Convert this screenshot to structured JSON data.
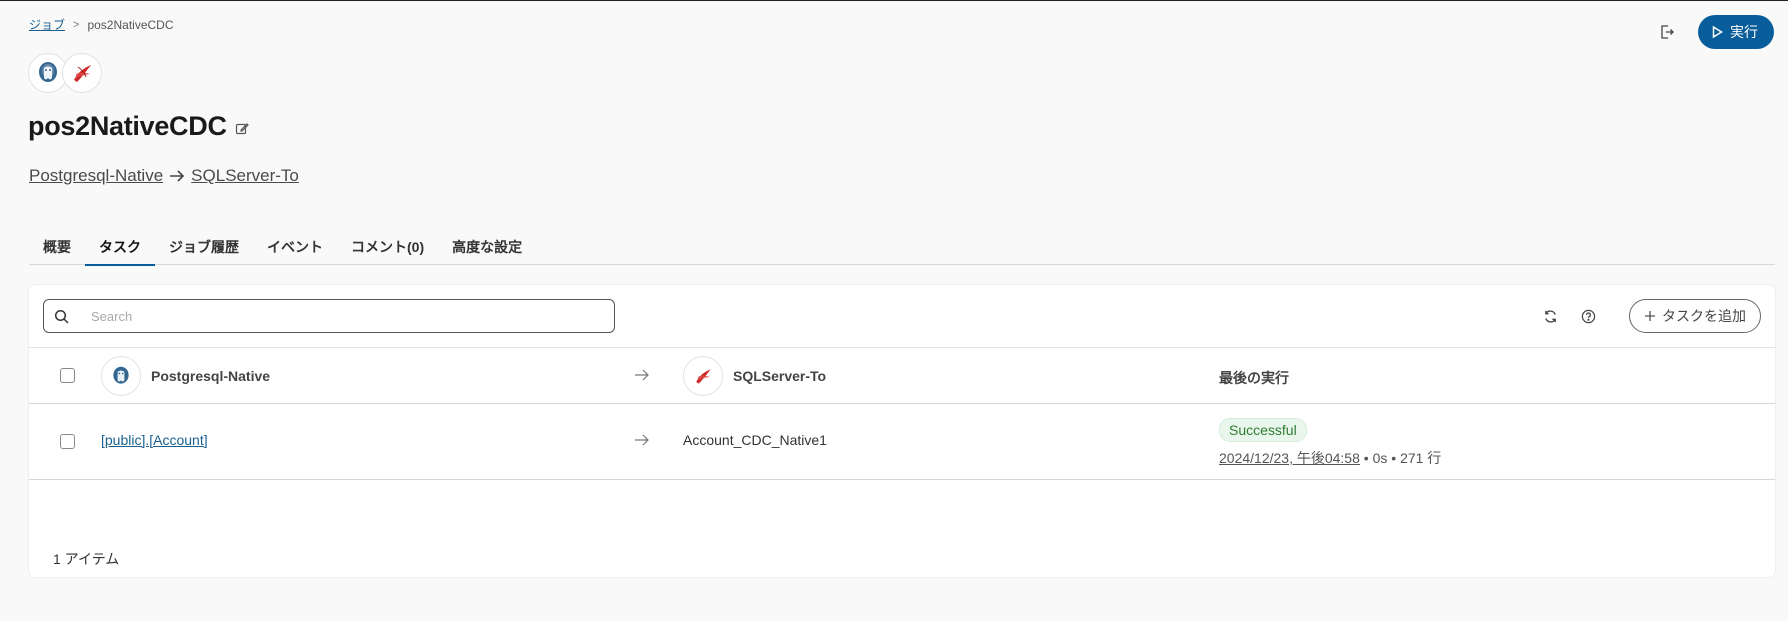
{
  "breadcrumb": {
    "root": "ジョブ",
    "separator": ">",
    "current": "pos2NativeCDC"
  },
  "header": {
    "run_label": "実行",
    "export_icon": "export-icon",
    "play_icon": "play-icon"
  },
  "job": {
    "title": "pos2NativeCDC",
    "source": "Postgresql-Native",
    "target": "SQLServer-To"
  },
  "tabs": [
    {
      "label": "概要"
    },
    {
      "label": "タスク",
      "active": true
    },
    {
      "label": "ジョブ履歴"
    },
    {
      "label": "イベント"
    },
    {
      "label": "コメント(0)"
    },
    {
      "label": "高度な設定"
    }
  ],
  "search": {
    "placeholder": "Search",
    "value": ""
  },
  "toolbar": {
    "add_task_label": "タスクを追加"
  },
  "table": {
    "headers": {
      "source": "Postgresql-Native",
      "target": "SQLServer-To",
      "last_run": "最後の実行"
    },
    "rows": [
      {
        "source": "[public].[Account]",
        "target": "Account_CDC_Native1",
        "status": "Successful",
        "timestamp": "2024/12/23, 午後04:58",
        "duration": "0s",
        "rows": "271 行"
      }
    ]
  },
  "footer": {
    "count": "1 アイテム"
  },
  "colors": {
    "accent": "#0a5d9b",
    "success_bg": "#e9f6ec",
    "success_text": "#2e7d32"
  }
}
